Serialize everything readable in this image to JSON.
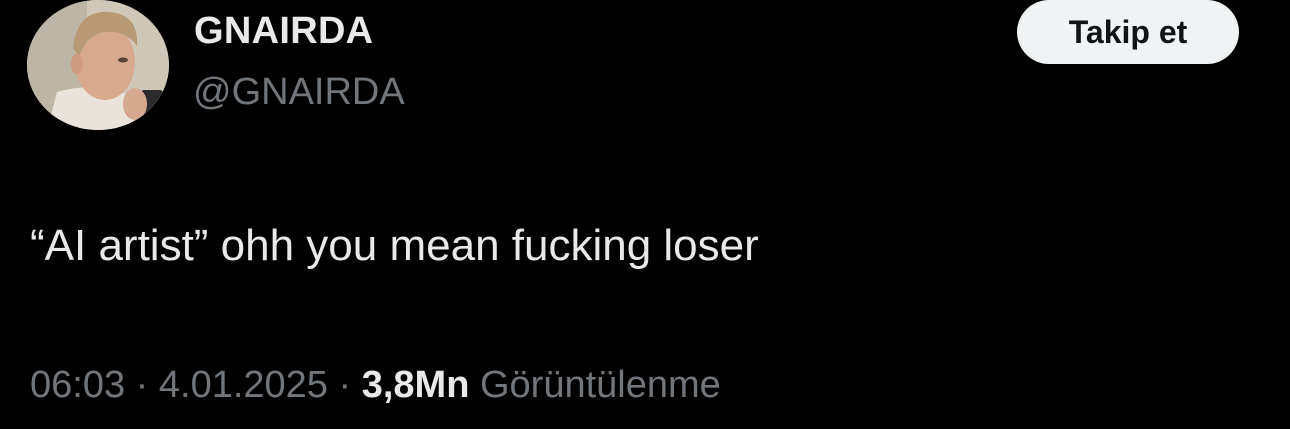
{
  "author": {
    "display_name": "GNAIRDA",
    "handle": "@GNAIRDA",
    "avatar": "profile-photo"
  },
  "follow_button": {
    "label": "Takip et"
  },
  "tweet": {
    "text": "“AI artist” ohh you mean fucking loser"
  },
  "meta": {
    "time": "06:03",
    "separator": " · ",
    "date": "4.01.2025",
    "views_count": "3,8Mn",
    "views_label": " Görüntülenme"
  },
  "colors": {
    "background": "#000000",
    "primary_text": "#e7e9ea",
    "secondary_text": "#71767b",
    "button_bg": "#eff3f4",
    "button_text": "#0f1419"
  }
}
